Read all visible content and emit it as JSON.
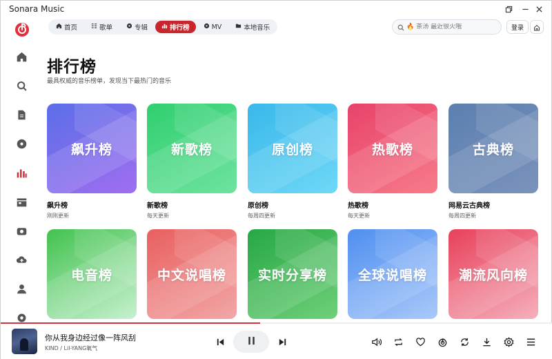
{
  "window": {
    "title": "Sonara Music"
  },
  "nav": {
    "tabs": [
      {
        "label": "首页",
        "icon": "home-icon",
        "active": false
      },
      {
        "label": "歌单",
        "icon": "list-icon",
        "active": false
      },
      {
        "label": "专辑",
        "icon": "disc-icon",
        "active": false
      },
      {
        "label": "排行榜",
        "icon": "chart-icon",
        "active": true
      },
      {
        "label": "MV",
        "icon": "video-icon",
        "active": false
      },
      {
        "label": "本地音乐",
        "icon": "folder-icon",
        "active": false
      }
    ]
  },
  "search": {
    "placeholder": "茶汤 最近很火哦"
  },
  "header": {
    "login_label": "登录"
  },
  "page": {
    "title": "排行榜",
    "subtitle": "最具权威的音乐榜单，发现当下最热门的音乐"
  },
  "charts": [
    {
      "cover_text": "飙升榜",
      "name": "飙升榜",
      "update": "刚刚更新",
      "color_from": "#5b6ee8",
      "color_to": "#a06ef0"
    },
    {
      "cover_text": "新歌榜",
      "name": "新歌榜",
      "update": "每天更新",
      "color_from": "#2fcf6f",
      "color_to": "#6fe3a0"
    },
    {
      "cover_text": "原创榜",
      "name": "原创榜",
      "update": "每周四更新",
      "color_from": "#38b8ea",
      "color_to": "#6fd8f7"
    },
    {
      "cover_text": "热歌榜",
      "name": "热歌榜",
      "update": "每天更新",
      "color_from": "#e8426a",
      "color_to": "#f77c8a"
    },
    {
      "cover_text": "古典榜",
      "name": "网易云古典榜",
      "update": "每周四更新",
      "color_from": "#5c7fb0",
      "color_to": "#7a93bb"
    },
    {
      "cover_text": "电音榜",
      "name": "",
      "update": "",
      "color_from": "#42c24e",
      "color_to": "#c7f1d0"
    },
    {
      "cover_text": "中文说唱榜",
      "name": "",
      "update": "",
      "color_from": "#e95f5f",
      "color_to": "#f2a7a7"
    },
    {
      "cover_text": "实时分享榜",
      "name": "",
      "update": "",
      "color_from": "#27a844",
      "color_to": "#6fd07a"
    },
    {
      "cover_text": "全球说唱榜",
      "name": "",
      "update": "",
      "color_from": "#4f8ff0",
      "color_to": "#a9c9fa"
    },
    {
      "cover_text": "潮流风向榜",
      "name": "",
      "update": "",
      "color_from": "#e8405a",
      "color_to": "#f5b0bd"
    }
  ],
  "player": {
    "song_title": "你从我身边经过像一阵风刮",
    "artist": "KIND / Lil-YANG氧气",
    "progress": 0.47
  },
  "colors": {
    "accent": "#c8262d",
    "sidebar_active": "#d3313d"
  }
}
